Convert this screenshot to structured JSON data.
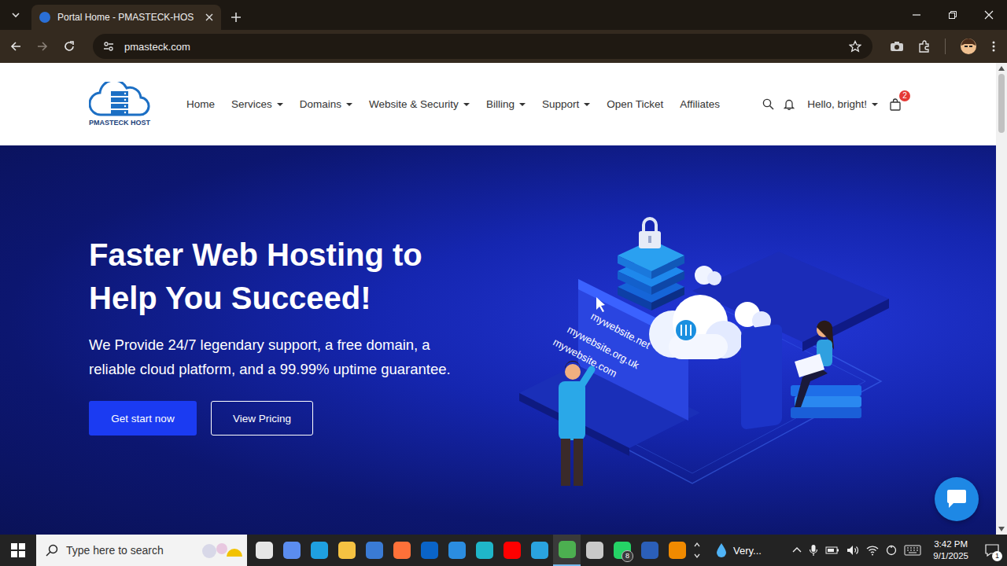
{
  "browser": {
    "tab": {
      "title": "Portal Home - PMASTECK-HOS",
      "selected": true
    },
    "url": "pmasteck.com"
  },
  "site": {
    "logo": "PMASTECK HOST",
    "nav": [
      {
        "label": "Home",
        "dropdown": false
      },
      {
        "label": "Services",
        "dropdown": true
      },
      {
        "label": "Domains",
        "dropdown": true
      },
      {
        "label": "Website & Security",
        "dropdown": true
      },
      {
        "label": "Billing",
        "dropdown": true
      },
      {
        "label": "Support",
        "dropdown": true
      },
      {
        "label": "Open Ticket",
        "dropdown": false
      },
      {
        "label": "Affiliates",
        "dropdown": false
      }
    ],
    "user_menu": {
      "label": "Hello, bright!",
      "dropdown": true
    },
    "cart_count": "2"
  },
  "hero": {
    "headline": [
      "Faster Web Hosting to",
      "Help You Succeed!"
    ],
    "text": [
      "We Provide 24/7 legendary support, a free domain, a",
      "reliable cloud platform, and a 99.99% uptime guarantee."
    ],
    "buttons": [
      {
        "label": "Get start now",
        "kind": "primary"
      },
      {
        "label": "View Pricing",
        "kind": "outline"
      }
    ],
    "illustration_labels": [
      "mywebsite.net",
      "mywebsite.org.uk",
      "mywebsite.com"
    ]
  },
  "taskbar": {
    "search_placeholder": "Type here to search",
    "apps": [
      {
        "color": "#e6e6e6",
        "badge": "",
        "active": false
      },
      {
        "color": "#5b8def",
        "badge": "",
        "active": false
      },
      {
        "color": "#1fa0e0",
        "badge": "",
        "active": false
      },
      {
        "color": "#f5c242",
        "badge": "",
        "active": false
      },
      {
        "color": "#3a7bd5",
        "badge": "",
        "active": false
      },
      {
        "color": "#ff7139",
        "badge": "",
        "active": false
      },
      {
        "color": "#0a64c8",
        "badge": "",
        "active": false
      },
      {
        "color": "#2b8de0",
        "badge": "",
        "active": false
      },
      {
        "color": "#1fb6c9",
        "badge": "",
        "active": false
      },
      {
        "color": "#ff0000",
        "badge": "",
        "active": false
      },
      {
        "color": "#2aa3df",
        "badge": "",
        "active": false
      },
      {
        "color": "#4caf50",
        "badge": "",
        "active": true
      },
      {
        "color": "#c9c9c9",
        "badge": "",
        "active": false
      },
      {
        "color": "#25d366",
        "badge": "8",
        "active": false
      },
      {
        "color": "#2b5fb8",
        "badge": "",
        "active": false
      },
      {
        "color": "#f08a00",
        "badge": "",
        "active": false
      }
    ],
    "weather": "Very...",
    "time": "3:42 PM",
    "date": "9/1/2025",
    "notifications": "1"
  }
}
